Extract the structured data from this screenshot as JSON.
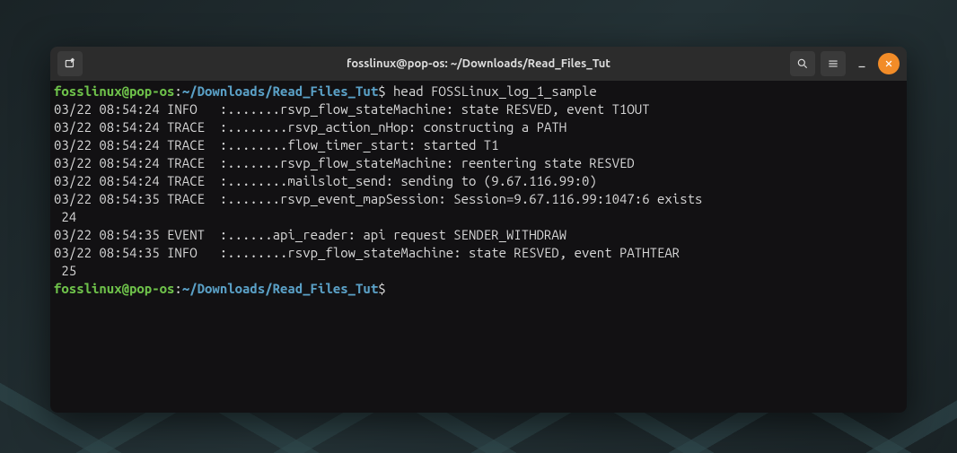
{
  "window": {
    "title": "fosslinux@pop-os: ~/Downloads/Read_Files_Tut"
  },
  "prompt": {
    "user_host": "fosslinux@pop-os",
    "colon": ":",
    "path": "~/Downloads/Read_Files_Tut",
    "symbol": "$ "
  },
  "command": "head FOSSLinux_log_1_sample",
  "output": [
    "03/22 08:54:24 INFO   :.......rsvp_flow_stateMachine: state RESVED, event T1OUT",
    "03/22 08:54:24 TRACE  :........rsvp_action_nHop: constructing a PATH",
    "03/22 08:54:24 TRACE  :........flow_timer_start: started T1",
    "03/22 08:54:24 TRACE  :.......rsvp_flow_stateMachine: reentering state RESVED",
    "03/22 08:54:24 TRACE  :........mailslot_send: sending to (9.67.116.99:0)",
    "03/22 08:54:35 TRACE  :.......rsvp_event_mapSession: Session=9.67.116.99:1047:6 exists",
    " 24",
    "03/22 08:54:35 EVENT  :......api_reader: api request SENDER_WITHDRAW",
    "03/22 08:54:35 INFO   :........rsvp_flow_stateMachine: state RESVED, event PATHTEAR",
    " 25"
  ],
  "prompt2": {
    "user_host": "fosslinux@pop-os",
    "colon": ":",
    "path": "~/Downloads/Read_Files_Tut",
    "symbol": "$ "
  }
}
